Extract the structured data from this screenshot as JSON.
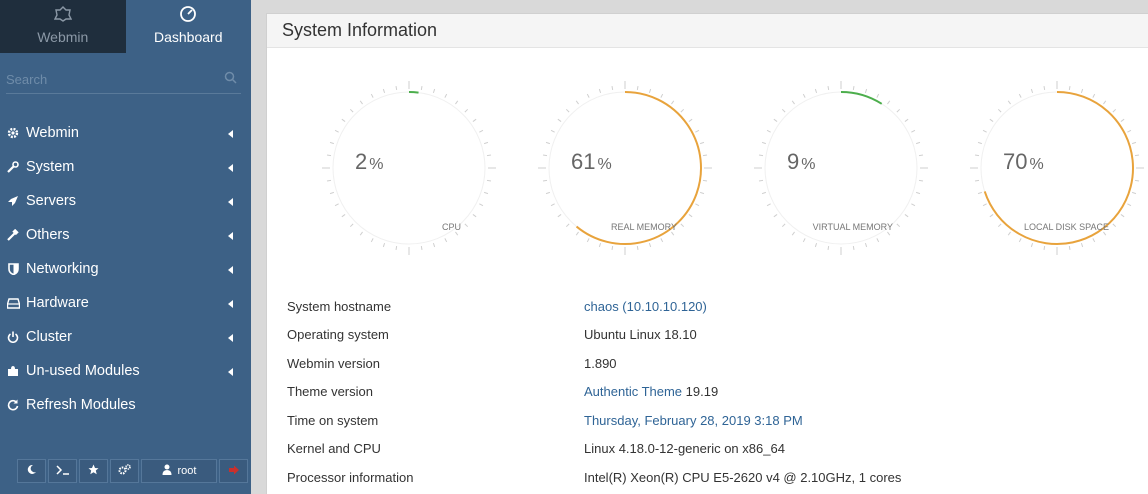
{
  "sidebar": {
    "tabs": {
      "webmin": "Webmin",
      "dashboard": "Dashboard"
    },
    "search_placeholder": "Search",
    "items": [
      {
        "label": "Webmin",
        "icon": "gear-icon"
      },
      {
        "label": "System",
        "icon": "wrench-icon"
      },
      {
        "label": "Servers",
        "icon": "rocket-icon"
      },
      {
        "label": "Others",
        "icon": "tools-icon"
      },
      {
        "label": "Networking",
        "icon": "shield-icon"
      },
      {
        "label": "Hardware",
        "icon": "hdd-icon"
      },
      {
        "label": "Cluster",
        "icon": "power-icon"
      },
      {
        "label": "Un-used Modules",
        "icon": "puzzle-icon"
      },
      {
        "label": "Refresh Modules",
        "icon": "refresh-icon"
      }
    ],
    "bottom": {
      "user": "root"
    }
  },
  "panel": {
    "title": "System Information"
  },
  "gauges": [
    {
      "value": "2",
      "unit": "%",
      "label": "CPU",
      "fraction": 0.02,
      "color": "#4cae4c"
    },
    {
      "value": "61",
      "unit": "%",
      "label": "REAL MEMORY",
      "fraction": 0.61,
      "color": "#e8a33c"
    },
    {
      "value": "9",
      "unit": "%",
      "label": "VIRTUAL MEMORY",
      "fraction": 0.09,
      "color": "#4cae4c"
    },
    {
      "value": "70",
      "unit": "%",
      "label": "LOCAL DISK SPACE",
      "fraction": 0.7,
      "color": "#e8a33c"
    }
  ],
  "info": {
    "hostname": {
      "key": "System hostname",
      "value": "chaos (10.10.10.120)"
    },
    "os": {
      "key": "Operating system",
      "value": "Ubuntu Linux 18.10"
    },
    "webmin": {
      "key": "Webmin version",
      "value": "1.890"
    },
    "theme": {
      "key": "Theme version",
      "link": "Authentic Theme",
      "version": "19.19"
    },
    "time": {
      "key": "Time on system",
      "value": "Thursday, February 28, 2019 3:18 PM"
    },
    "kernel": {
      "key": "Kernel and CPU",
      "value": "Linux 4.18.0-12-generic on x86_64"
    },
    "cpu": {
      "key": "Processor information",
      "value": "Intel(R) Xeon(R) CPU E5-2620 v4 @ 2.10GHz, 1 cores"
    }
  }
}
